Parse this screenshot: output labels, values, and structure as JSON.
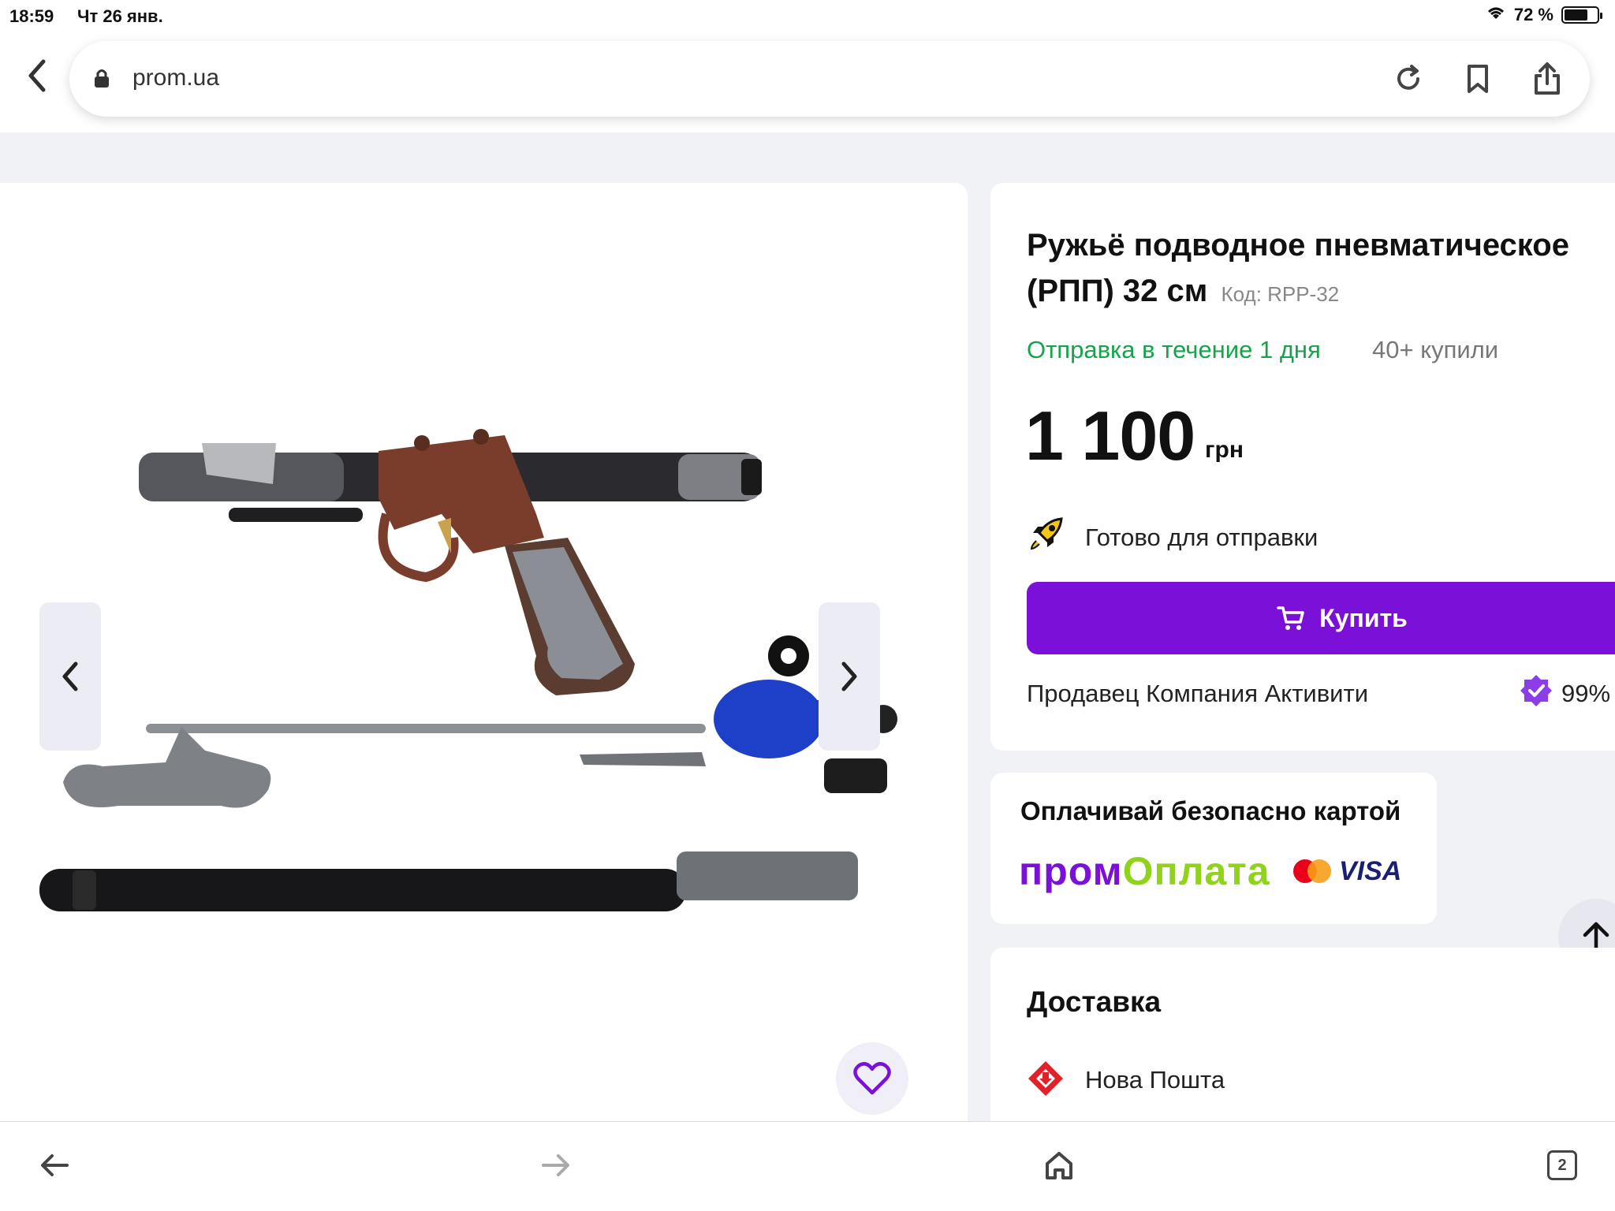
{
  "status_bar": {
    "time": "18:59",
    "date": "Чт 26 янв.",
    "battery": "72 %",
    "battery_level": 0.72
  },
  "browser": {
    "url": "prom.ua"
  },
  "product": {
    "title": "Ружьё подводное пневматическое (РПП) 32 см",
    "code_label": "Код: RPP-32",
    "shipping": "Отправка в течение 1 дня",
    "bought": "40+ купили",
    "price": "1 100",
    "currency": "грн",
    "ready_text": "Готово для отправки",
    "buy_label": "Купить",
    "seller": "Продавец Компания Активити",
    "rating": "99%"
  },
  "payment": {
    "title": "Оплачивай безопасно картой",
    "brand_part1": "пром",
    "brand_part2": "Оплата",
    "visa": "VISA"
  },
  "delivery": {
    "title": "Доставка",
    "carrier": "Нова Пошта"
  },
  "toolbar": {
    "tabs_count": "2"
  },
  "colors": {
    "accent": "#7b11d9",
    "shipping_green": "#16a34a",
    "page_bg": "#f1f2f6"
  }
}
